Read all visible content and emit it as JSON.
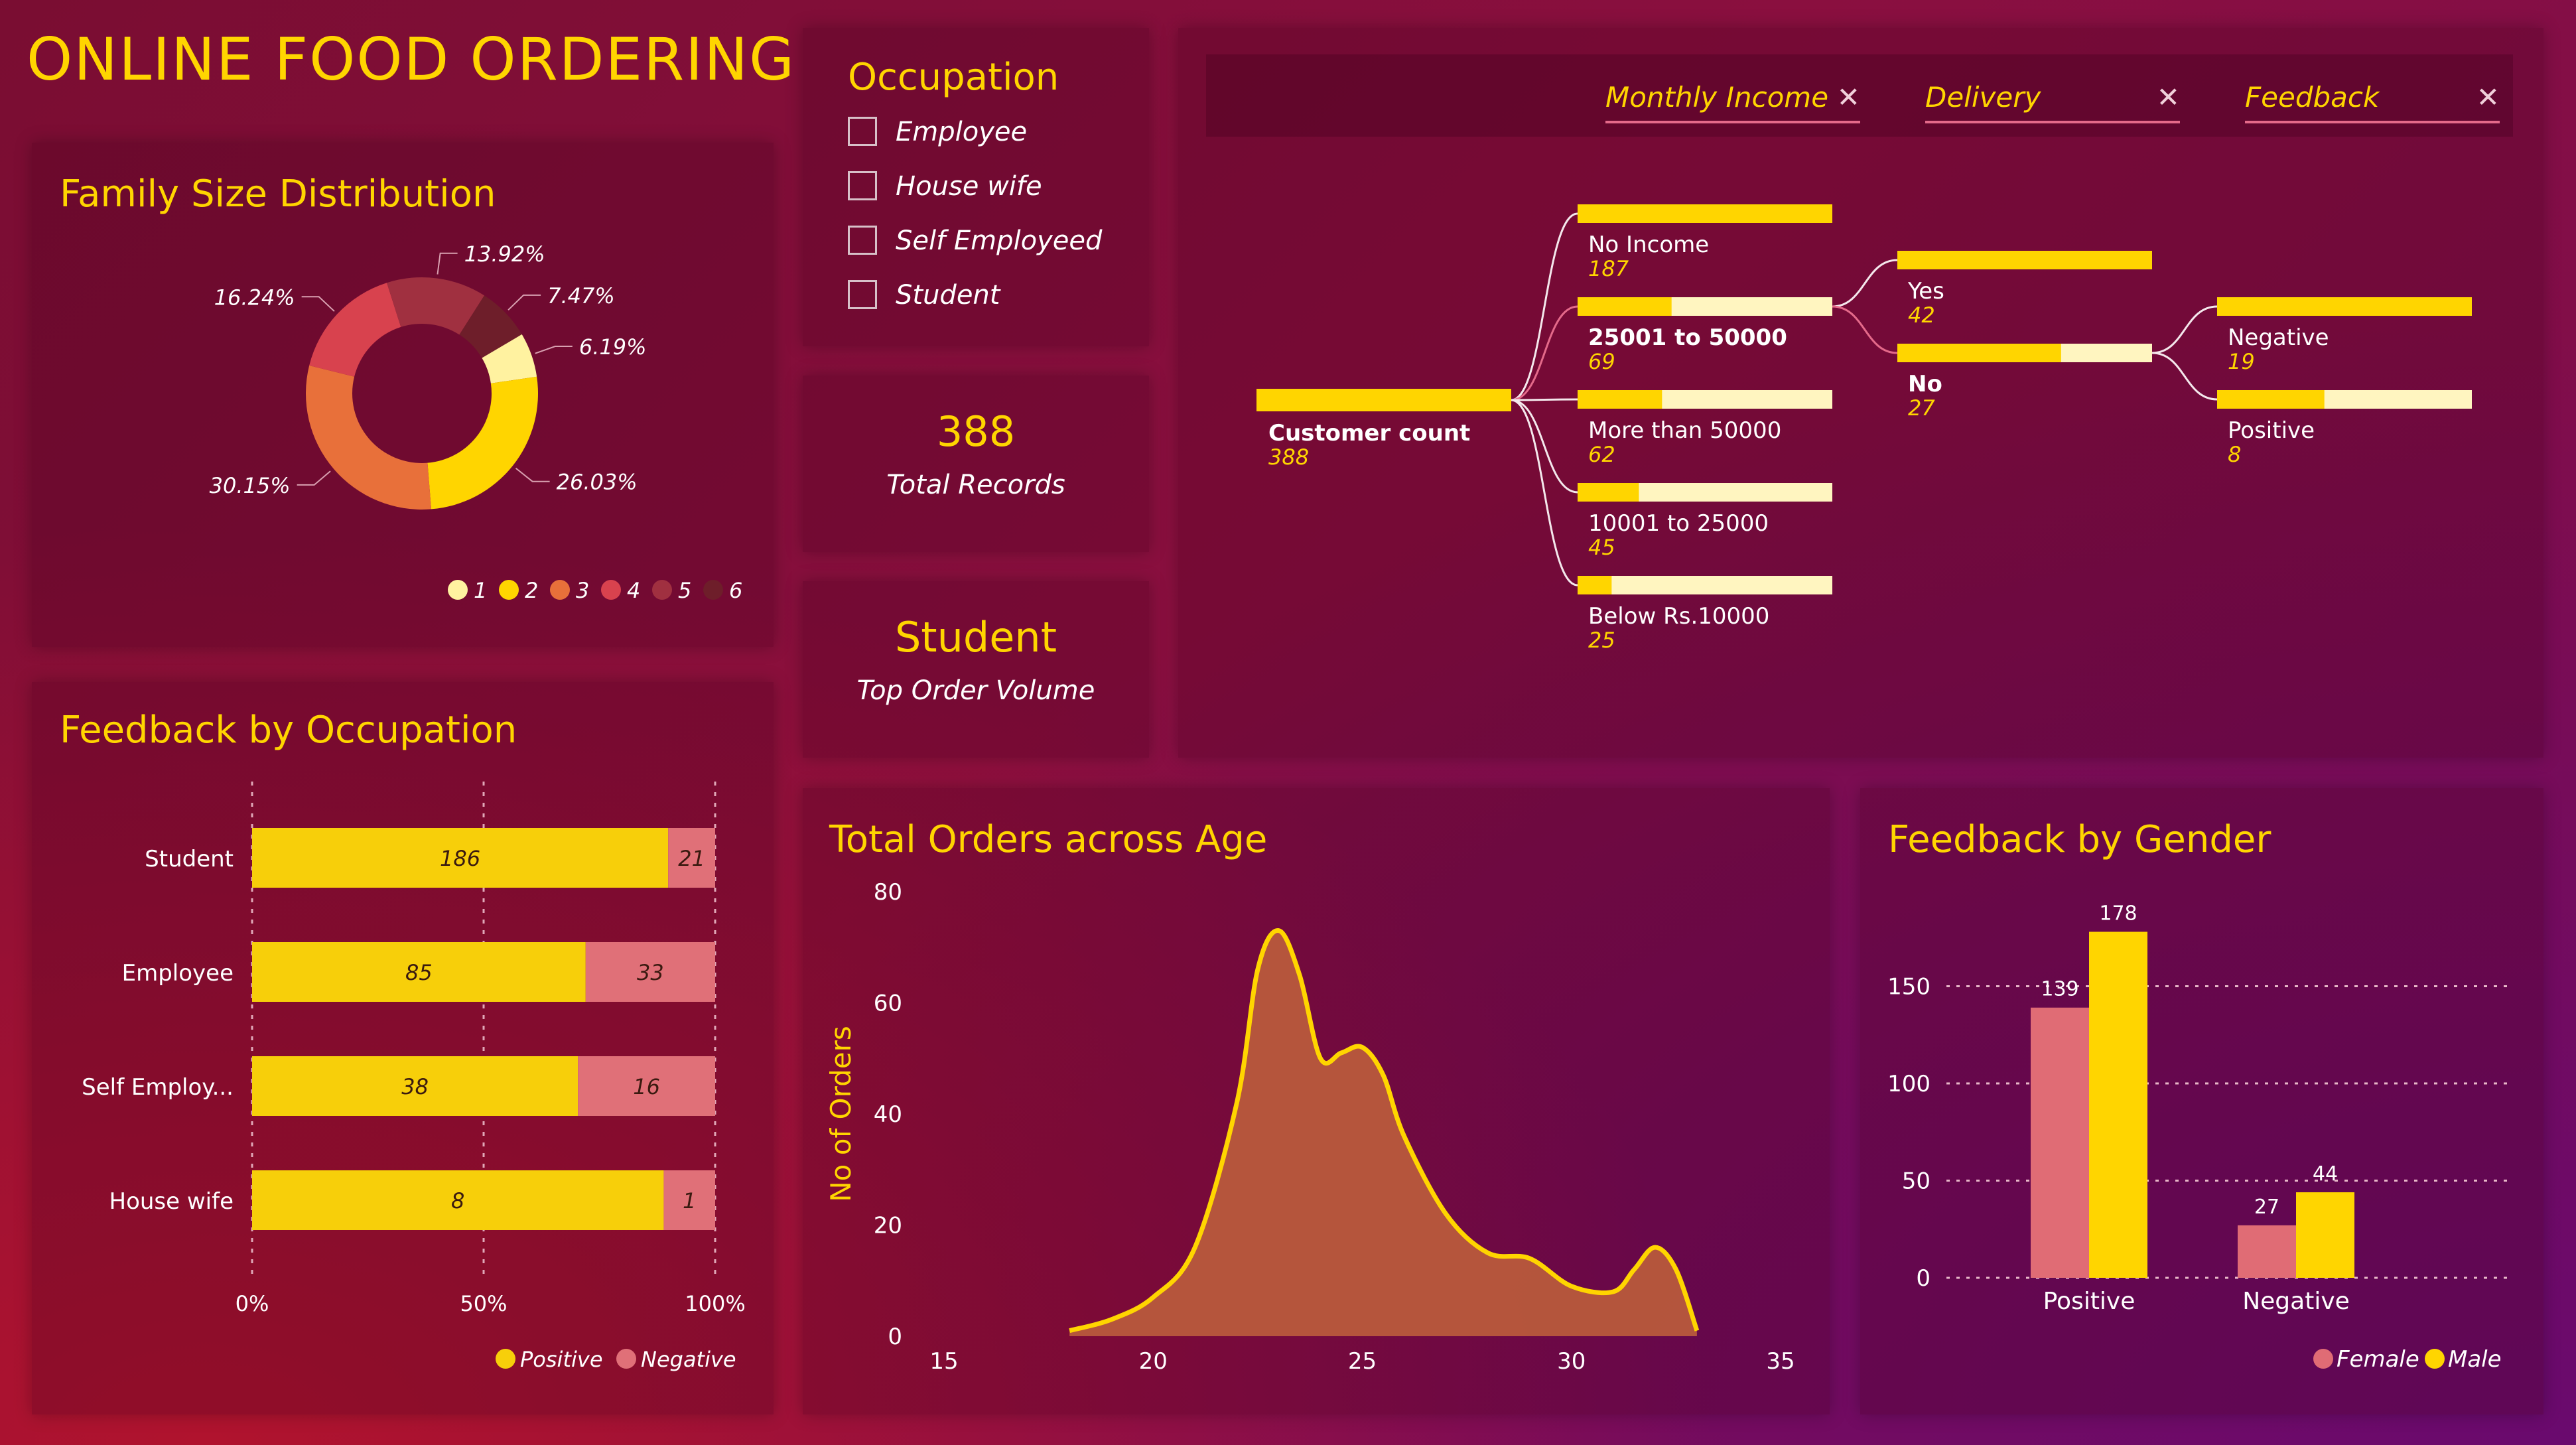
{
  "title": "ONLINE FOOD ORDERING",
  "family": {
    "title": "Family Size Distribution",
    "legend": [
      "1",
      "2",
      "3",
      "4",
      "5",
      "6"
    ],
    "colors": [
      "#fff2a0",
      "#ffd500",
      "#e8703a",
      "#d8424e",
      "#a03040",
      "#6e1e2a"
    ]
  },
  "occupation_filter": {
    "title": "Occupation",
    "items": [
      "Employee",
      "House wife",
      "Self Employeed",
      "Student"
    ]
  },
  "cards": {
    "total_value": "388",
    "total_label": "Total Records",
    "top_value": "Student",
    "top_label": "Top Order Volume"
  },
  "tree": {
    "filters": [
      "Monthly Income",
      "Delivery",
      "Feedback"
    ],
    "close_glyph": "✕",
    "root_label": "Customer count",
    "root_value": "388"
  },
  "feedback_occ": {
    "title": "Feedback by Occupation",
    "positive_color": "#f7cf0a",
    "negative_color": "#e07078"
  },
  "orders_age": {
    "title": "Total Orders across Age",
    "area_color": "#b85a3c",
    "line_color": "#ffd500"
  },
  "feedback_gender": {
    "title": "Feedback by Gender",
    "female_color": "#e06c75",
    "male_color": "#ffd500"
  },
  "chart_data": [
    {
      "type": "pie",
      "title": "Family Size Distribution",
      "categories": [
        "1",
        "2",
        "3",
        "4",
        "5",
        "6"
      ],
      "values": [
        6.19,
        26.03,
        30.15,
        16.24,
        13.92,
        7.47
      ],
      "labels": [
        "6.19%",
        "26.03%",
        "30.15%",
        "16.24%",
        "13.92%",
        "7.47%"
      ],
      "legend": "bottom-right"
    },
    {
      "type": "bar",
      "subtype": "horizontal-100%-stacked",
      "title": "Feedback by Occupation",
      "categories": [
        "Student",
        "Employee",
        "Self Employ...",
        "House wife"
      ],
      "series": [
        {
          "name": "Positive",
          "values": [
            186,
            85,
            38,
            8
          ]
        },
        {
          "name": "Negative",
          "values": [
            21,
            33,
            16,
            1
          ]
        }
      ],
      "x_ticks": [
        "0%",
        "50%",
        "100%"
      ],
      "legend": "bottom-right"
    },
    {
      "type": "area",
      "title": "Total Orders across Age",
      "ylabel": "No of Orders",
      "xlim": [
        15,
        35
      ],
      "ylim": [
        0,
        80
      ],
      "x_ticks": [
        15,
        20,
        25,
        30,
        35
      ],
      "y_ticks": [
        0,
        20,
        40,
        60,
        80
      ],
      "x": [
        18,
        19,
        20,
        21,
        22,
        22.5,
        23,
        23.5,
        24,
        24.5,
        25,
        25.5,
        26,
        27,
        28,
        29,
        30,
        31,
        31.5,
        32,
        32.5,
        33
      ],
      "y": [
        1,
        3,
        7,
        16,
        42,
        66,
        73,
        65,
        50,
        51,
        52,
        47,
        36,
        22,
        15,
        14,
        9,
        8,
        12,
        16,
        12,
        1
      ]
    },
    {
      "type": "bar",
      "title": "Feedback by Gender",
      "categories": [
        "Positive",
        "Negative"
      ],
      "series": [
        {
          "name": "Female",
          "values": [
            139,
            27
          ]
        },
        {
          "name": "Male",
          "values": [
            178,
            44
          ]
        }
      ],
      "ylim": [
        0,
        200
      ],
      "y_ticks": [
        0,
        50,
        100,
        150
      ],
      "legend": "bottom-right"
    },
    {
      "type": "decomposition-tree",
      "root": {
        "label": "Customer count",
        "value": 388
      },
      "levels": [
        {
          "name": "Monthly Income",
          "nodes": [
            {
              "label": "No Income",
              "value": 187
            },
            {
              "label": "25001 to 50000",
              "value": 69,
              "selected": true
            },
            {
              "label": "More than 50000",
              "value": 62
            },
            {
              "label": "10001 to 25000",
              "value": 45
            },
            {
              "label": "Below Rs.10000",
              "value": 25
            }
          ]
        },
        {
          "name": "Delivery",
          "nodes": [
            {
              "label": "Yes",
              "value": 42
            },
            {
              "label": "No",
              "value": 27,
              "selected": true
            }
          ]
        },
        {
          "name": "Feedback",
          "nodes": [
            {
              "label": "Negative",
              "value": 19
            },
            {
              "label": "Positive",
              "value": 8
            }
          ]
        }
      ]
    }
  ]
}
